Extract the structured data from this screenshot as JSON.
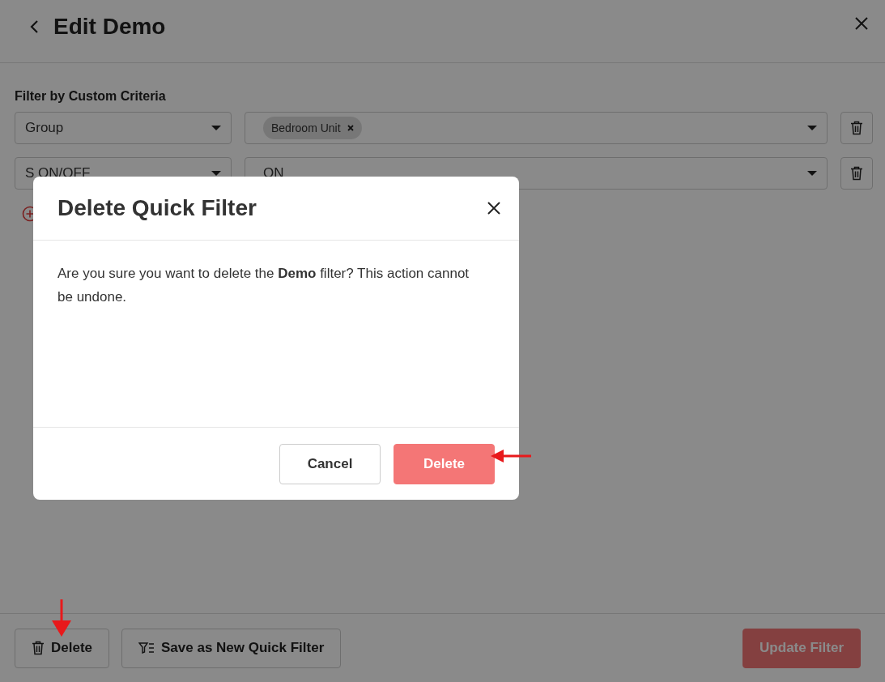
{
  "header": {
    "title": "Edit Demo"
  },
  "filter_section": {
    "label": "Filter by Custom Criteria",
    "rows": [
      {
        "field": "Group",
        "values": [
          "Bedroom Unit"
        ],
        "value_text": ""
      },
      {
        "field": "S ON/OFF",
        "values": [],
        "value_text": "ON"
      }
    ]
  },
  "footer": {
    "delete_button": "Delete",
    "save_button": "Save as New Quick Filter",
    "update_button": "Update Filter"
  },
  "dialog": {
    "title": "Delete Quick Filter",
    "message": "Are you sure you want to delete the **Demo** filter? This action cannot be undone.",
    "cancel_button": "Cancel",
    "delete_button": "Delete"
  }
}
